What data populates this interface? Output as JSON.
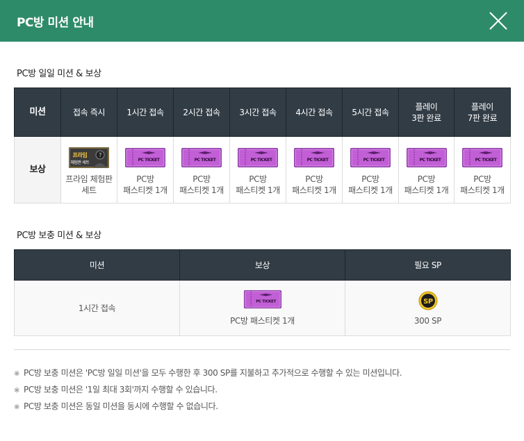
{
  "header": {
    "title": "PC방 미션 안내",
    "colors": {
      "background": "#2e8b6a"
    }
  },
  "daily": {
    "title": "PC방 일일 미션 & 보상",
    "mission_label": "미션",
    "reward_label": "보상",
    "columns": [
      {
        "mission": "접속 즉시",
        "reward_line1": "프라임 체험판",
        "reward_line2": "세트",
        "reward_icon": "prime-trial-set-icon"
      },
      {
        "mission": "1시간 접속",
        "reward_line1": "PC방",
        "reward_line2": "패스티켓 1개",
        "reward_icon": "pc-ticket-icon"
      },
      {
        "mission": "2시간 접속",
        "reward_line1": "PC방",
        "reward_line2": "패스티켓 1개",
        "reward_icon": "pc-ticket-icon"
      },
      {
        "mission": "3시간 접속",
        "reward_line1": "PC방",
        "reward_line2": "패스티켓 1개",
        "reward_icon": "pc-ticket-icon"
      },
      {
        "mission": "4시간 접속",
        "reward_line1": "PC방",
        "reward_line2": "패스티켓 1개",
        "reward_icon": "pc-ticket-icon"
      },
      {
        "mission": "5시간 접속",
        "reward_line1": "PC방",
        "reward_line2": "패스티켓 1개",
        "reward_icon": "pc-ticket-icon"
      },
      {
        "mission_line1": "플레이",
        "mission_line2": "3판 완료",
        "reward_line1": "PC방",
        "reward_line2": "패스티켓 1개",
        "reward_icon": "pc-ticket-icon"
      },
      {
        "mission_line1": "플레이",
        "mission_line2": "7판 완료",
        "reward_line1": "PC방",
        "reward_line2": "패스티켓 1개",
        "reward_icon": "pc-ticket-icon"
      }
    ],
    "ticket_text": "PC TICKET",
    "prime_text_line1": "프라임",
    "prime_text_line2": "체험판 세트"
  },
  "bonus": {
    "title": "PC방 보충 미션 & 보상",
    "headers": [
      "미션",
      "보상",
      "필요 SP"
    ],
    "row": {
      "mission": "1시간 접속",
      "reward": "PC방 패스티켓 1개",
      "sp": "300 SP",
      "sp_icon_text": "SP"
    }
  },
  "notes": [
    "PC방 보충 미션은 'PC방 일일 미션'을 모두 수행한 후 300 SP를 지불하고 추가적으로 수행할 수 있는 미션입니다.",
    "PC방 보충 미션은 '1일 최대 3회'까지 수행할 수 있습니다.",
    "PC방 보충 미션은 동일 미션을 동시에 수행할 수 없습니다."
  ],
  "note_mark": "※"
}
